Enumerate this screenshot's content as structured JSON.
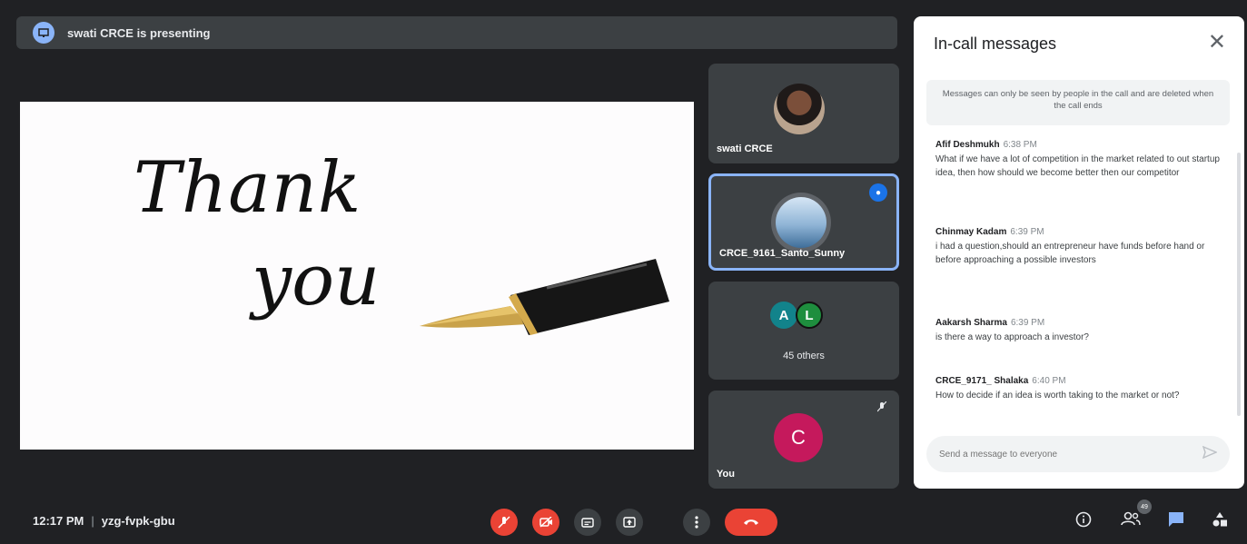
{
  "presenting_banner": "swati CRCE is presenting",
  "slide": {
    "line1": "Thank",
    "line2": "you"
  },
  "tiles": {
    "speaker1_name": "swati CRCE",
    "speaker2_name": "CRCE_9161_Santo_Sunny",
    "others_initial_a": "A",
    "others_initial_l": "L",
    "others_label": "45 others",
    "self_initial": "C",
    "self_name": "You"
  },
  "chat": {
    "title": "In-call messages",
    "close_label": "✕",
    "notice": "Messages can only be seen by people in the call and are deleted when the call ends",
    "messages": [
      {
        "author": "Afif Deshmukh",
        "time": "6:38 PM",
        "text": "What if we have a lot of competition in the market related to out startup idea, then how should we become better then our competitor"
      },
      {
        "author": "Chinmay Kadam",
        "time": "6:39 PM",
        "text": "i had a question,should an entrepreneur have funds before hand or before approaching a possible investors"
      },
      {
        "author": "Aakarsh Sharma",
        "time": "6:39 PM",
        "text": "is there a way to approach a investor?"
      },
      {
        "author": "CRCE_9171_ Shalaka",
        "time": "6:40 PM",
        "text": "How to decide if an idea is worth taking to the market or not?"
      }
    ],
    "input_placeholder": "Send a message to everyone"
  },
  "bottom_bar": {
    "time": "12:17 PM",
    "meeting_code": "yzg-fvpk-gbu",
    "participants_count": "49"
  },
  "icons": {
    "present": "present-icon",
    "mic_off": "mic-off-icon",
    "cam_off": "camera-off-icon",
    "captions": "captions-icon",
    "present_now": "present-now-icon",
    "more": "more-options-icon",
    "hangup": "hang-up-icon",
    "info": "info-icon",
    "people": "people-icon",
    "chat": "chat-icon",
    "activities": "activities-icon"
  },
  "colors": {
    "accent": "#8ab4f8",
    "danger": "#ea4335",
    "background": "#202124"
  }
}
